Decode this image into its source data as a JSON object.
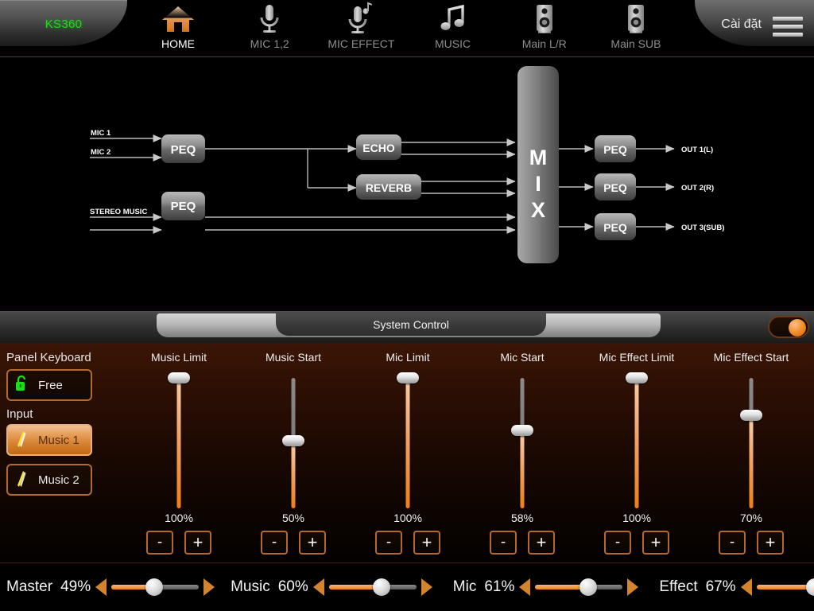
{
  "header": {
    "device_name": "KS360",
    "settings_label": "Cài đặt",
    "menu_icon": "hamburger-menu-icon",
    "tabs": [
      {
        "label": "HOME",
        "icon": "home-icon",
        "active": true
      },
      {
        "label": "MIC 1,2",
        "icon": "microphone-icon",
        "active": false
      },
      {
        "label": "MIC EFFECT",
        "icon": "microphone-effect-icon",
        "active": false
      },
      {
        "label": "MUSIC",
        "icon": "music-note-icon",
        "active": false
      },
      {
        "label": "Main L/R",
        "icon": "speaker-icon",
        "active": false
      },
      {
        "label": "Main SUB",
        "icon": "speaker-icon",
        "active": false
      }
    ]
  },
  "diagram": {
    "inputs": [
      "MIC 1",
      "MIC 2",
      "STEREO MUSIC"
    ],
    "mic_peq": "PEQ",
    "music_peq": "PEQ",
    "effects": [
      "ECHO",
      "REVERB"
    ],
    "mixer": "MIX",
    "mixer_letters": [
      "M",
      "I",
      "X"
    ],
    "out_peq": [
      "PEQ",
      "PEQ",
      "PEQ"
    ],
    "outputs": [
      "OUT 1(L)",
      "OUT 2(R)",
      "OUT 3(SUB)"
    ]
  },
  "system_control": {
    "title": "System Control",
    "toggle_on": true,
    "toggle_name": "system-control-power-toggle"
  },
  "panel": {
    "panel_keyboard": {
      "title": "Panel Keyboard",
      "state_label": "Free",
      "icon": "unlock-icon"
    },
    "input": {
      "title": "Input",
      "options": [
        {
          "label": "Music 1",
          "selected": true,
          "icon": "music-source-icon"
        },
        {
          "label": "Music 2",
          "selected": false,
          "icon": "music-source-icon"
        }
      ]
    },
    "minus_label": "-",
    "plus_label": "+",
    "sliders": [
      {
        "label": "Music Limit",
        "value": "100%",
        "percent": 100
      },
      {
        "label": "Music Start",
        "value": "50%",
        "percent": 50
      },
      {
        "label": "Mic Limit",
        "value": "100%",
        "percent": 100
      },
      {
        "label": "Mic Start",
        "value": "58%",
        "percent": 58
      },
      {
        "label": "Mic Effect Limit",
        "value": "100%",
        "percent": 100
      },
      {
        "label": "Mic Effect Start",
        "value": "70%",
        "percent": 70
      }
    ]
  },
  "bottom_bar": {
    "controls": [
      {
        "name": "Master",
        "value": "49%",
        "percent": 49
      },
      {
        "name": "Music",
        "value": "60%",
        "percent": 60
      },
      {
        "name": "Mic",
        "value": "61%",
        "percent": 61
      },
      {
        "name": "Effect",
        "value": "67%",
        "percent": 67
      }
    ]
  },
  "colors": {
    "accent_orange": "#ef7f16",
    "logo_green": "#16e016",
    "panel_bg_top": "#3b1505",
    "border_orange": "#b26a2e"
  }
}
